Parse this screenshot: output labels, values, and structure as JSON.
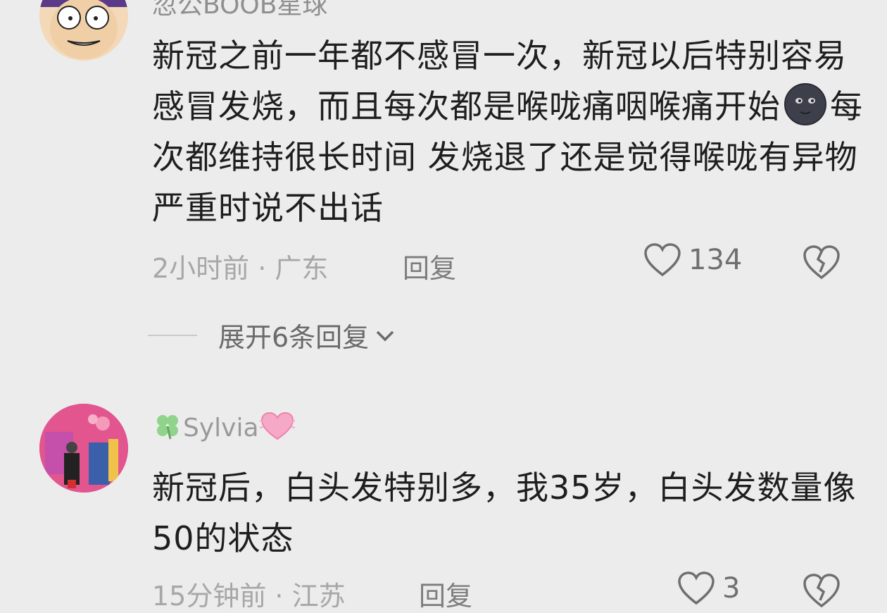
{
  "comments": [
    {
      "username": "忽公BOOB星球",
      "content_before_emoji": "新冠之前一年都不感冒一次，新冠以后特别容易感冒发烧，而且每次都是喉咙痛咽喉痛开始",
      "emoji": "new-moon-face-emoji",
      "content_after_emoji": "每次都维持很长时间 发烧退了还是觉得喉咙有异物 严重时说不出话",
      "time_location": "2小时前 · 广东",
      "reply_label": "回复",
      "likes": "134",
      "expand_replies_label": "展开6条回复"
    },
    {
      "username": "Sylvia",
      "username_prefix_icon": "four-leaf-clover-icon",
      "username_suffix_icon": "heart-icon",
      "content": "新冠后，白头发特别多，我35岁，白头发数量像50的状态",
      "time_location": "15分钟前 · 江苏",
      "reply_label": "回复",
      "likes": "3"
    }
  ],
  "colors": {
    "background": "#ececec",
    "text_primary": "#1e1e1e",
    "text_secondary": "#a7a7a7"
  }
}
